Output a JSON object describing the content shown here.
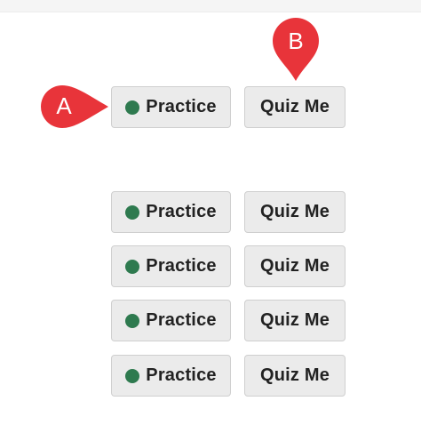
{
  "colors": {
    "practice_dot": "#2e7a4f",
    "marker": "#e8343a",
    "button_bg": "#ebebeb",
    "button_border": "#cfcfcf"
  },
  "markers": {
    "a": {
      "label": "A",
      "icon": "callout-pointer-right"
    },
    "b": {
      "label": "B",
      "icon": "map-pin-pointer-down"
    }
  },
  "rows": [
    {
      "practice_label": "Practice",
      "quiz_label": "Quiz Me",
      "status_icon": "green-dot"
    },
    {
      "practice_label": "Practice",
      "quiz_label": "Quiz Me",
      "status_icon": "green-dot"
    },
    {
      "practice_label": "Practice",
      "quiz_label": "Quiz Me",
      "status_icon": "green-dot"
    },
    {
      "practice_label": "Practice",
      "quiz_label": "Quiz Me",
      "status_icon": "green-dot"
    },
    {
      "practice_label": "Practice",
      "quiz_label": "Quiz Me",
      "status_icon": "green-dot"
    }
  ]
}
